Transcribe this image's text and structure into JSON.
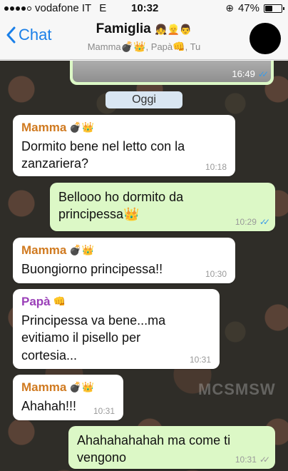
{
  "status_bar": {
    "carrier": "vodafone IT",
    "network": "E",
    "time": "10:32",
    "battery": "47%",
    "battery_level": 0.47
  },
  "nav": {
    "back_label": "Chat",
    "title": "Famiglia",
    "title_emojis": "👧👱👨",
    "subtitle_mamma": "Mamma",
    "subtitle_papa": "Papà",
    "subtitle_tu": ", Tu"
  },
  "chat": {
    "photo_time": "16:49",
    "date_separator": "Oggi",
    "watermark": "MCSMSW",
    "messages": [
      {
        "sender": "Mamma",
        "emojis": "💣👑",
        "text": "Dormito bene nel letto con la zanzariera?",
        "time": "10:18"
      },
      {
        "text": "Bellooo ho dormito da principessa👑",
        "time": "10:29",
        "ticks": "✓✓"
      },
      {
        "sender": "Mamma",
        "emojis": "💣👑",
        "text": "Buongiorno principessa!!",
        "time": "10:30"
      },
      {
        "sender": "Papà",
        "emojis": "👊",
        "text": "Principessa va bene...ma evitiamo il pisello per cortesia...",
        "time": "10:31"
      },
      {
        "sender": "Mamma",
        "emojis": "💣👑",
        "text": "Ahahah!!!",
        "time": "10:31"
      },
      {
        "text": "Ahahahahahah ma come ti vengono",
        "time": "10:31",
        "ticks": "✓✓"
      }
    ]
  },
  "colors": {
    "accent": "#1a7fe8",
    "outgoing_bubble": "#dcf8c6",
    "incoming_bubble": "#ffffff",
    "mamma_name": "#d07a20",
    "papa_name": "#9a3fb8",
    "read_ticks": "#3a9be8"
  }
}
